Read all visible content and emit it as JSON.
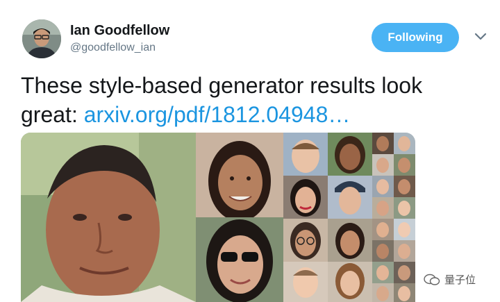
{
  "author": {
    "name": "Ian Goodfellow",
    "handle": "@goodfellow_ian",
    "avatar_icon": "profile-avatar"
  },
  "follow_button": {
    "label": "Following",
    "color": "#4ab3f4"
  },
  "menu": {
    "icon": "chevron-down-icon"
  },
  "tweet": {
    "text": "These style-based generator results look great: ",
    "link": "arxiv.org/pdf/1812.04948…",
    "link_color": "#1b95e0"
  },
  "media": {
    "description_icon": "generated-faces-grid-image"
  },
  "watermark": {
    "text": "量子位"
  }
}
